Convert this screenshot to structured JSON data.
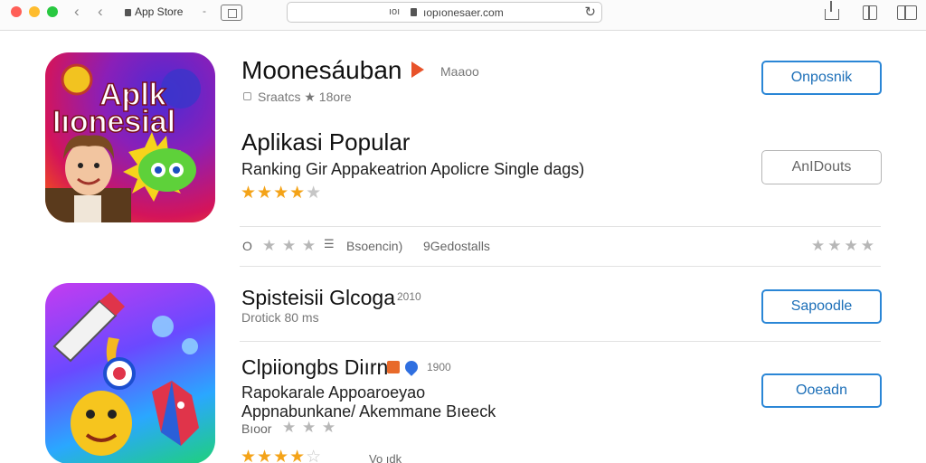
{
  "browser": {
    "tab_label": "App Store",
    "tab_dash": "-",
    "url_prefix": "ıoı",
    "url": "ıopıonesaer.com",
    "icons": [
      "back-icon",
      "forward-icon",
      "lock-icon",
      "sidebar-icon",
      "reload-icon",
      "share-icon",
      "tabs-icon",
      "new-window-icon"
    ]
  },
  "apps": [
    {
      "icon_text_1": "Aplk",
      "icon_text_2": "Iıonesial",
      "title": "Moonesáuban",
      "title_tag": "Maaoo",
      "subtitle": "Sraatcs ★ 18ore",
      "button": "Onposnik"
    },
    {
      "title": "Aplikasi Popular",
      "description": "Ranking Gir Appakeatrion Apolicre Single dags)",
      "rating": 4,
      "rating_max": 5,
      "button": "AnIDouts"
    },
    {
      "meta_prefix": "O",
      "meta_rating": 2,
      "meta_text_1": "Bsoencin)",
      "meta_text_2": "9Gedostalls",
      "right_rating": 4
    },
    {
      "title": "Spisteisii Glcoga",
      "title_tag": "2010",
      "subtitle": "Drotick 80 ms",
      "button": "Sapoodle"
    },
    {
      "title": "Clpiiongbs Diırn",
      "title_tag": "1900",
      "description_1": "Rapokarale Appoaroeyao",
      "description_2": "Appnabunkane/ Akemmane Bıeeck",
      "meta_text": "Bıoor",
      "meta_rating": 3,
      "rating": 4.5,
      "button": "Ooeadn",
      "footer_text": "Vo ıdk"
    }
  ],
  "colors": {
    "accent_blue": "#2a86d6",
    "star_gold": "#f4a318",
    "star_gray": "#c6c6c6"
  }
}
